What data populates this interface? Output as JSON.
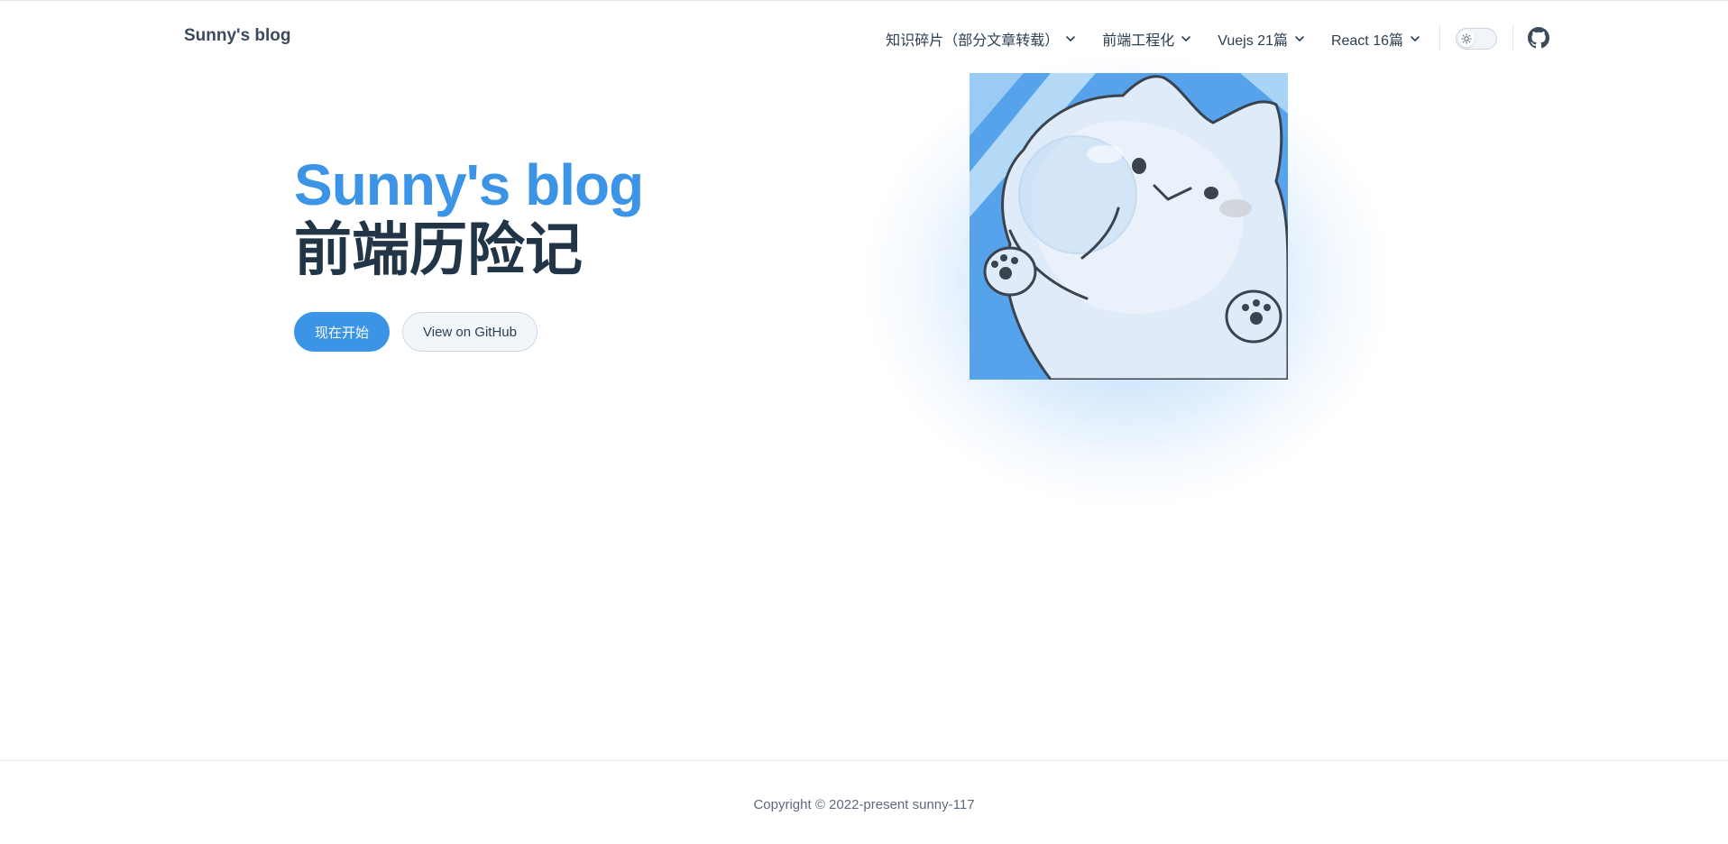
{
  "nav": {
    "site_title": "Sunny's blog",
    "items": [
      {
        "label": "知识碎片（部分文章转载）",
        "icon": "chevron-down-icon"
      },
      {
        "label": "前端工程化",
        "icon": "chevron-down-icon"
      },
      {
        "label": "Vuejs 21篇",
        "icon": "chevron-down-icon"
      },
      {
        "label": "React 16篇",
        "icon": "chevron-down-icon"
      }
    ],
    "theme_toggle_icon": "sun-icon",
    "social_icon": "github-icon"
  },
  "hero": {
    "name": "Sunny's blog",
    "text": "前端历险记",
    "actions": {
      "primary_label": "现在开始",
      "secondary_label": "View on GitHub"
    },
    "image_icon": "cartoon-cat-image"
  },
  "footer": {
    "copyright": "Copyright © 2022-present sunny-117"
  },
  "colors": {
    "brand": "#3b94e6",
    "text": "#213547",
    "border": "#e2e8f0"
  }
}
